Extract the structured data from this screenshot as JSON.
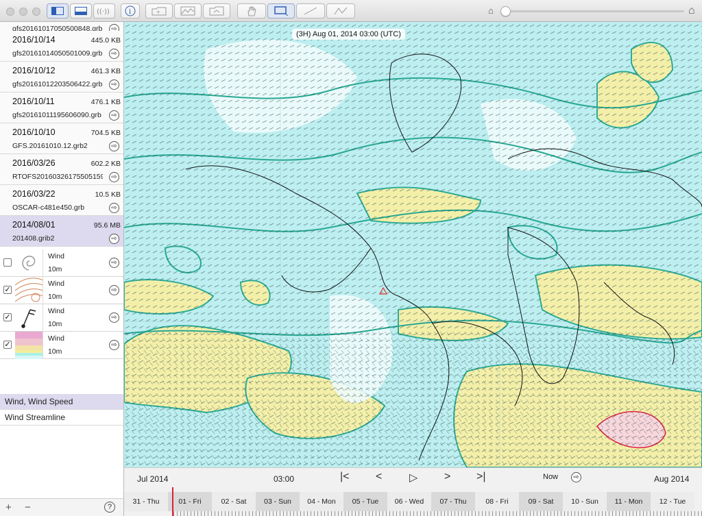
{
  "map": {
    "time_label": "(3H) Aug 01, 2014 03:00 (UTC)"
  },
  "files": [
    {
      "date": "",
      "size": "",
      "name": "gfs20161017050500848.grb"
    },
    {
      "date": "2016/10/14",
      "size": "445.0 KB",
      "name": "gfs20161014050501009.grb"
    },
    {
      "date": "2016/10/12",
      "size": "461.3 KB",
      "name": "gfs20161012203506422.grb"
    },
    {
      "date": "2016/10/11",
      "size": "476.1 KB",
      "name": "gfs20161011195606090.grb"
    },
    {
      "date": "2016/10/10",
      "size": "704.5 KB",
      "name": "GFS.20161010.12.grb2"
    },
    {
      "date": "2016/03/26",
      "size": "602.2 KB",
      "name": "RTOFS20160326175505159"
    },
    {
      "date": "2016/03/22",
      "size": "10.5 KB",
      "name": "OSCAR-c481e450.grb"
    },
    {
      "date": "2014/08/01",
      "size": "95.6 MB",
      "name": "201408.grib2"
    }
  ],
  "layers": [
    {
      "name": "Wind",
      "level": "10m",
      "checked": false,
      "thumb": "streamline-icon"
    },
    {
      "name": "Wind",
      "level": "10m",
      "checked": true,
      "thumb": "contour-icon"
    },
    {
      "name": "Wind",
      "level": "10m",
      "checked": true,
      "thumb": "wind-barb-icon"
    },
    {
      "name": "Wind",
      "level": "10m",
      "checked": true,
      "thumb": "color-fill-icon"
    }
  ],
  "named_layers": [
    "Wind, Wind Speed",
    "Wind Streamline"
  ],
  "timeline": {
    "month_left": "Jul 2014",
    "month_right": "Aug 2014",
    "time": "03:00",
    "now_label": "Now",
    "days": [
      "31 - Thu",
      "01 - Fri",
      "02 - Sat",
      "03 - Sun",
      "04 - Mon",
      "05 - Tue",
      "06 - Wed",
      "07 - Thu",
      "08 - Fri",
      "09 - Sat",
      "10 - Sun",
      "11 - Mon",
      "12 - Tue"
    ]
  },
  "symbols": {
    "add": "+",
    "remove": "−",
    "help": "?",
    "check": "✓",
    "arrow": "⇨"
  },
  "colors": {
    "map_low": "#bdeef0",
    "map_high": "#f6f0a6",
    "contour": "#27a892",
    "selected_row": "#ddd9ee"
  }
}
